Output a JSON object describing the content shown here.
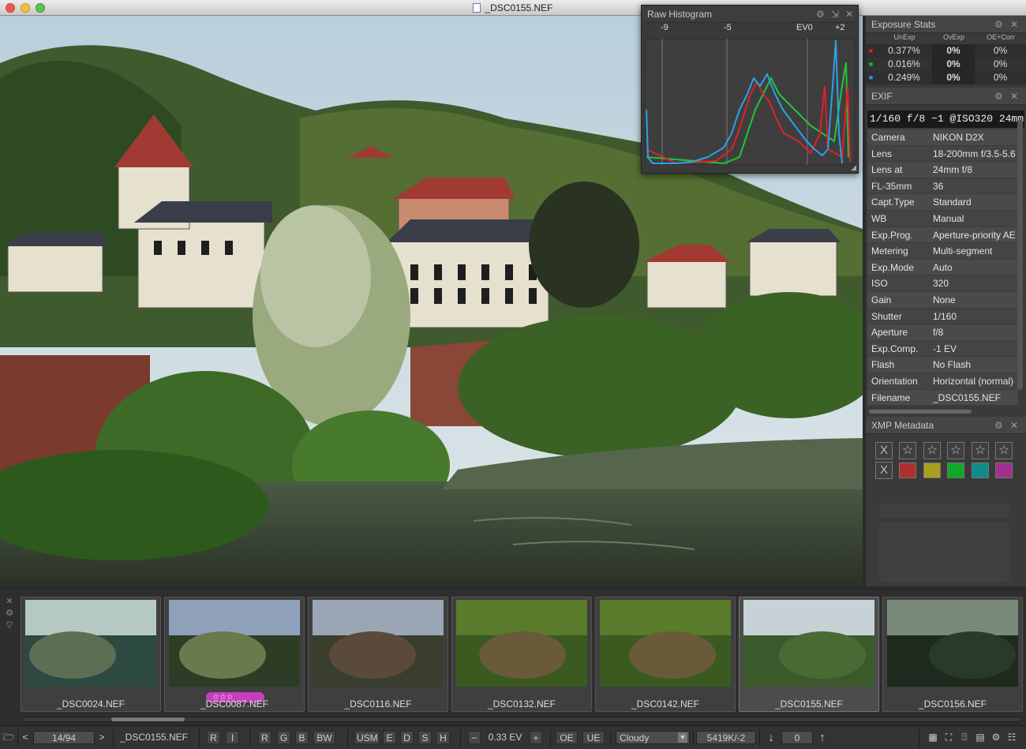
{
  "window": {
    "title": "_DSC0155.NEF"
  },
  "histogram": {
    "title": "Raw Histogram",
    "scale_labels": [
      "-9",
      "-5",
      "EV0",
      "+2"
    ],
    "colors": {
      "red": "#e0202a",
      "green": "#1fc63a",
      "blue": "#2aa1e8"
    }
  },
  "exposure_stats": {
    "title": "Exposure Stats",
    "headers": [
      "UnExp",
      "OvExp",
      "OE+Corr"
    ],
    "rows": [
      {
        "channel": "R",
        "color": "#d02020",
        "unexp": "0.377%",
        "ovexp": "0%",
        "oecorr": "0%"
      },
      {
        "channel": "G",
        "color": "#20b030",
        "unexp": "0.016%",
        "ovexp": "0%",
        "oecorr": "0%"
      },
      {
        "channel": "B",
        "color": "#2a90e0",
        "unexp": "0.249%",
        "ovexp": "0%",
        "oecorr": "0%"
      }
    ]
  },
  "exif": {
    "title": "EXIF",
    "summary": "1/160 f/8 −1 @ISO320 24mm",
    "rows": [
      {
        "key": "Camera",
        "value": "NIKON D2X"
      },
      {
        "key": "Lens",
        "value": "18-200mm f/3.5-5.6"
      },
      {
        "key": "Lens at",
        "value": "24mm f/8"
      },
      {
        "key": "FL-35mm",
        "value": "36"
      },
      {
        "key": "Capt.Type",
        "value": "Standard"
      },
      {
        "key": "WB",
        "value": "Manual"
      },
      {
        "key": "Exp.Prog.",
        "value": "Aperture-priority AE"
      },
      {
        "key": "Metering",
        "value": "Multi-segment"
      },
      {
        "key": "Exp.Mode",
        "value": "Auto"
      },
      {
        "key": "ISO",
        "value": "320"
      },
      {
        "key": "Gain",
        "value": "None"
      },
      {
        "key": "Shutter",
        "value": "1/160"
      },
      {
        "key": "Aperture",
        "value": "f/8"
      },
      {
        "key": "Exp.Comp.",
        "value": "-1 EV"
      },
      {
        "key": "Flash",
        "value": "No Flash"
      },
      {
        "key": "Orientation",
        "value": "Horizontal (normal)"
      },
      {
        "key": "Filename",
        "value": "_DSC0155.NEF"
      }
    ]
  },
  "xmp": {
    "title": "XMP Metadata",
    "reject_label": "X",
    "star_glyph": "☆",
    "color_labels": [
      "#b03030",
      "#a8a020",
      "#10a828",
      "#108a8a",
      "#a03090"
    ]
  },
  "filmstrip": {
    "thumbs": [
      {
        "name": "_DSC0024.NEF",
        "rating": ""
      },
      {
        "name": "_DSC0087.NEF",
        "rating": "☆☆☆"
      },
      {
        "name": "_DSC0116.NEF",
        "rating": ""
      },
      {
        "name": "_DSC0132.NEF",
        "rating": ""
      },
      {
        "name": "_DSC0142.NEF",
        "rating": ""
      },
      {
        "name": "_DSC0155.NEF",
        "rating": ""
      },
      {
        "name": "_DSC0156.NEF",
        "rating": ""
      }
    ],
    "selected_index": 5
  },
  "statusbar": {
    "position": "14/94",
    "filename": "_DSC0155.NEF",
    "buttons_a": [
      "R",
      "I"
    ],
    "buttons_b": [
      "R",
      "G",
      "B",
      "BW"
    ],
    "buttons_c": [
      "USM",
      "E",
      "D",
      "S",
      "H"
    ],
    "minus": "−",
    "ev": "0.33 EV",
    "plus": "+",
    "oe": "OE",
    "ue": "UE",
    "wb_preset": "Cloudy",
    "wb_value": "5419K/-2",
    "rotate_value": "0",
    "prev": "<",
    "next": ">"
  }
}
